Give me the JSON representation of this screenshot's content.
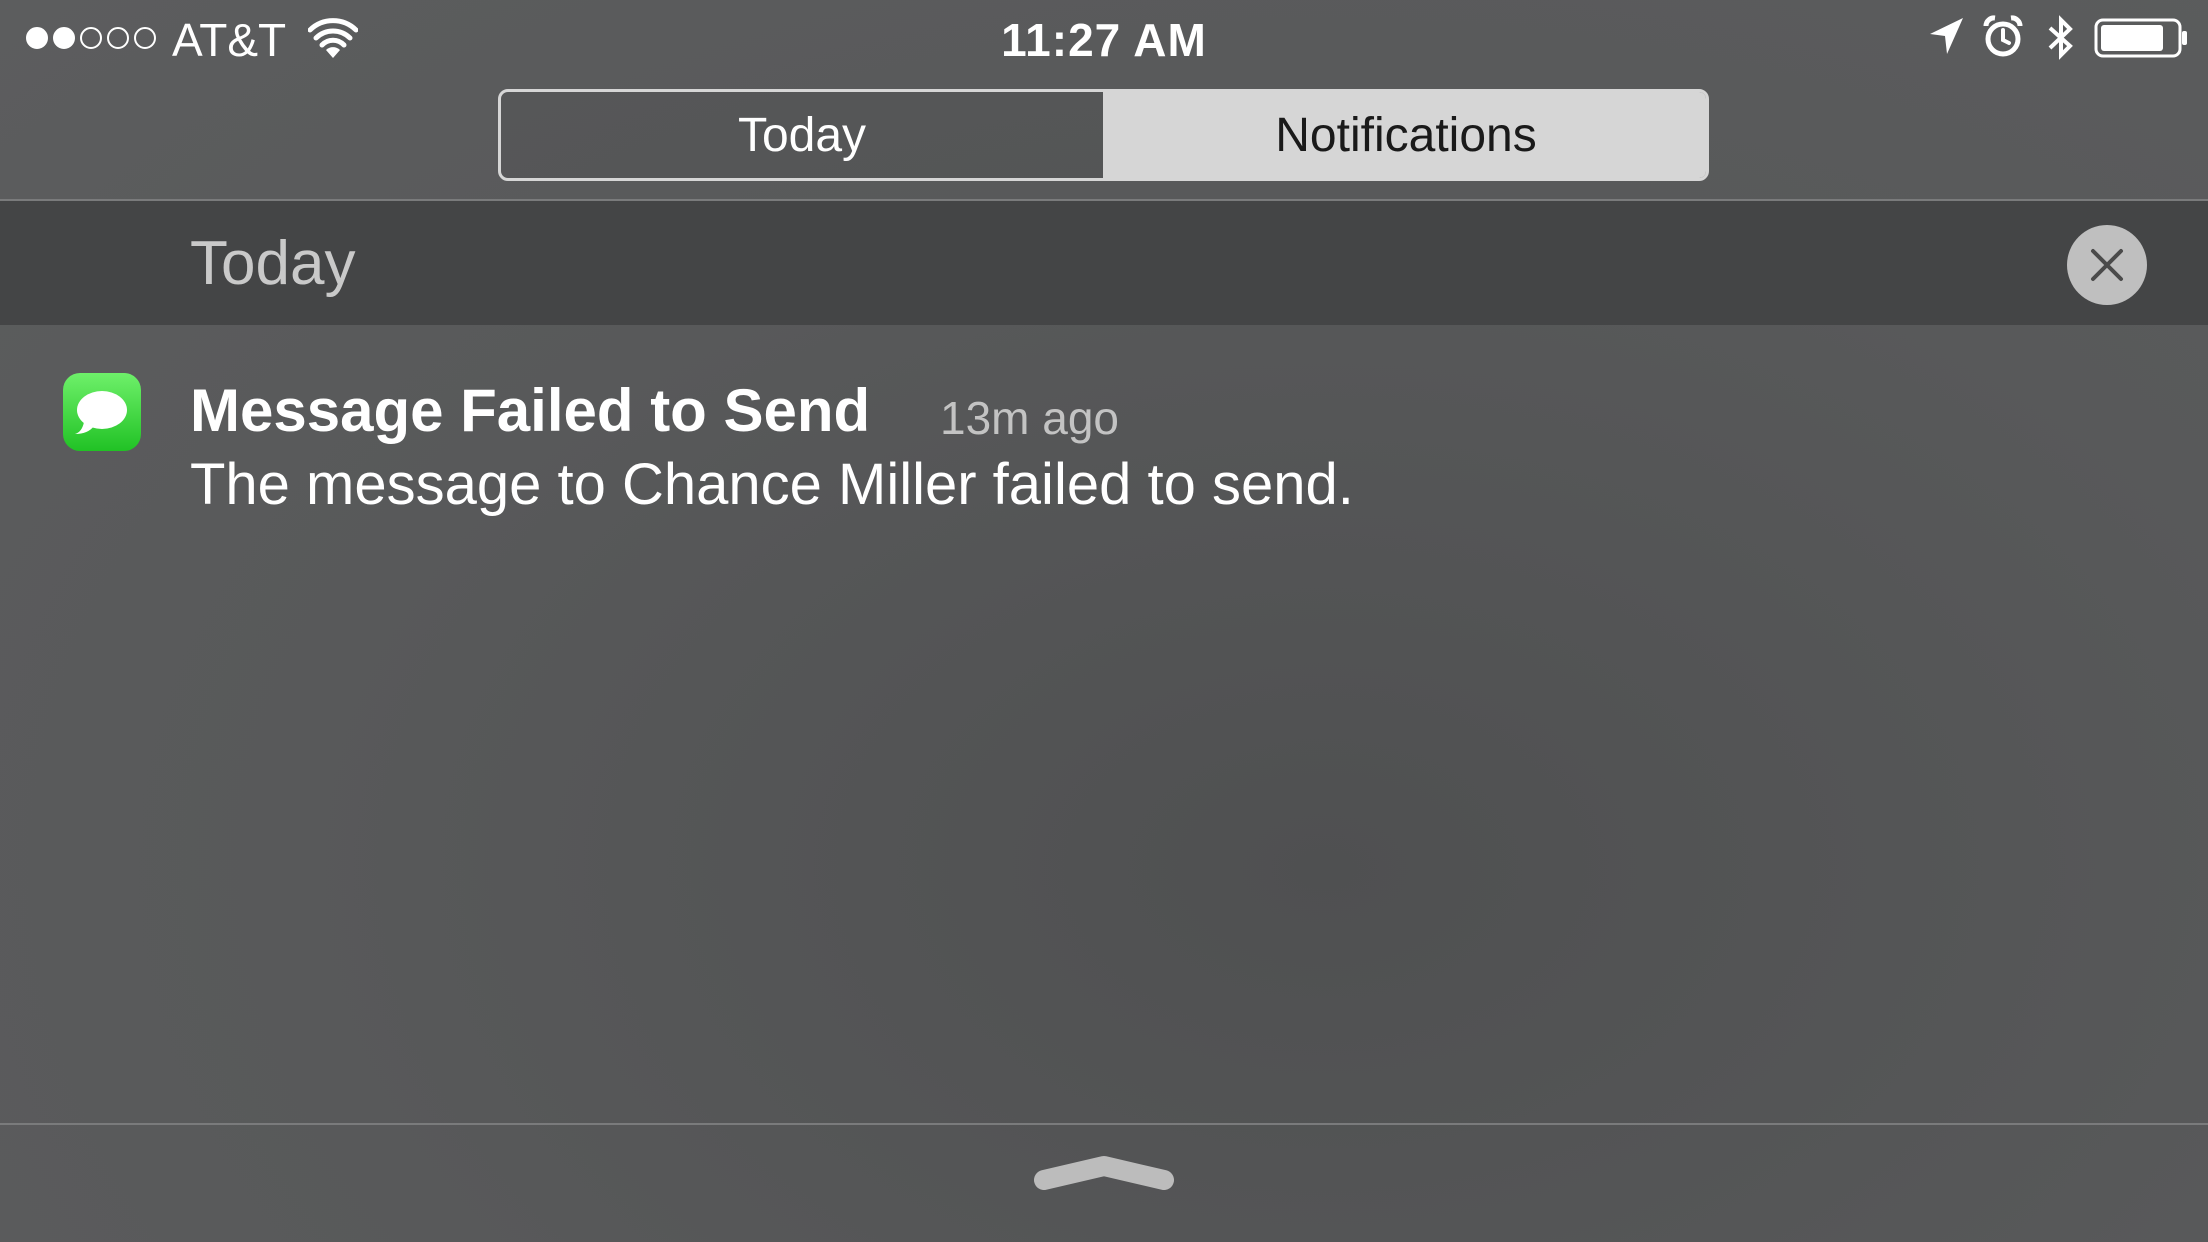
{
  "status_bar": {
    "signal_strength": 2,
    "signal_max": 5,
    "carrier": "AT&T",
    "time": "11:27 AM",
    "icons": [
      "wifi-icon",
      "location-arrow-icon",
      "alarm-clock-icon",
      "bluetooth-icon",
      "battery-icon"
    ],
    "battery_level": 0.8
  },
  "segmented_control": {
    "segments": [
      {
        "label": "Today",
        "selected": false
      },
      {
        "label": "Notifications",
        "selected": true
      }
    ]
  },
  "section": {
    "title": "Today",
    "clear_icon": "close-icon"
  },
  "notification": {
    "app_icon": "messages-icon",
    "title": "Message Failed to Send",
    "time": "13m ago",
    "body": "The message to Chance Miller failed to send."
  },
  "footer": {
    "grabber_icon": "grabber-handle-icon"
  },
  "colors": {
    "background": "#58595a",
    "header_band": "#444546",
    "segment_selected": "#d6d6d6",
    "messages_green": "#34c759"
  }
}
